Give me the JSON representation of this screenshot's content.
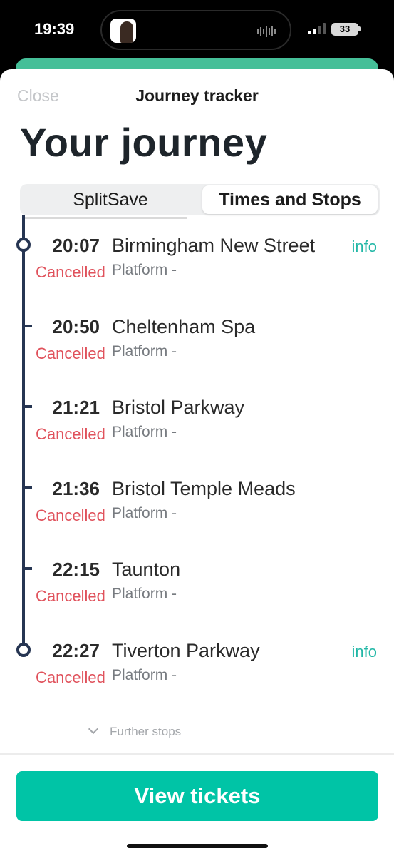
{
  "status_bar": {
    "time": "19:39",
    "battery": "33",
    "icons": [
      "signal-icon",
      "battery-icon",
      "audio-wave-icon"
    ]
  },
  "header": {
    "close_label": "Close",
    "title": "Journey tracker"
  },
  "page_title": "Your journey",
  "tabs": [
    {
      "label": "SplitSave",
      "selected": false
    },
    {
      "label": "Times and Stops",
      "selected": true
    }
  ],
  "stops": [
    {
      "time": "20:07",
      "name": "Birmingham New Street",
      "status": "Cancelled",
      "platform": "Platform -",
      "info": "info"
    },
    {
      "time": "20:50",
      "name": "Cheltenham Spa",
      "status": "Cancelled",
      "platform": "Platform -",
      "info": ""
    },
    {
      "time": "21:21",
      "name": "Bristol Parkway",
      "status": "Cancelled",
      "platform": "Platform -",
      "info": ""
    },
    {
      "time": "21:36",
      "name": "Bristol Temple Meads",
      "status": "Cancelled",
      "platform": "Platform -",
      "info": ""
    },
    {
      "time": "22:15",
      "name": "Taunton",
      "status": "Cancelled",
      "platform": "Platform -",
      "info": ""
    },
    {
      "time": "22:27",
      "name": "Tiverton Parkway",
      "status": "Cancelled",
      "platform": "Platform -",
      "info": "info"
    }
  ],
  "further_stops_label": "Further stops",
  "cta_label": "View tickets",
  "colors": {
    "accent": "#00c4a6",
    "cancelled": "#e0525c",
    "timeline": "#263552",
    "info": "#21b7a6"
  }
}
